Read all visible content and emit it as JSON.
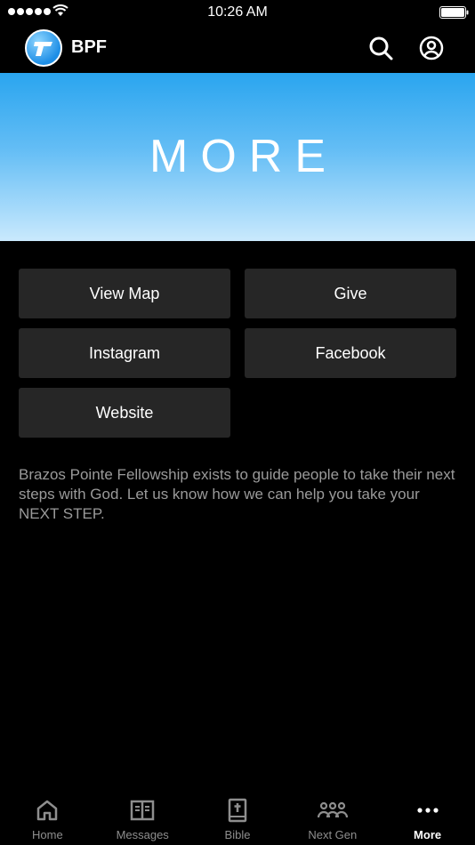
{
  "status_bar": {
    "time": "10:26 AM"
  },
  "header": {
    "app_name": "BPF"
  },
  "banner": {
    "title": "MORE"
  },
  "tiles": [
    {
      "label": "View Map"
    },
    {
      "label": "Give"
    },
    {
      "label": "Instagram"
    },
    {
      "label": "Facebook"
    },
    {
      "label": "Website"
    }
  ],
  "intro_text": "Brazos Pointe Fellowship exists to guide people to take their next steps with God. Let us know how we can help you take your NEXT STEP.",
  "tab_bar": {
    "tabs": [
      {
        "label": "Home",
        "icon": "home-icon"
      },
      {
        "label": "Messages",
        "icon": "book-open-icon"
      },
      {
        "label": "Bible",
        "icon": "bible-icon"
      },
      {
        "label": "Next Gen",
        "icon": "people-icon"
      },
      {
        "label": "More",
        "icon": "ellipsis-icon"
      }
    ],
    "active": "More"
  },
  "colors": {
    "banner_top": "#2aa5ef",
    "banner_bottom": "#c9e9fd",
    "tile_bg": "#262626"
  }
}
